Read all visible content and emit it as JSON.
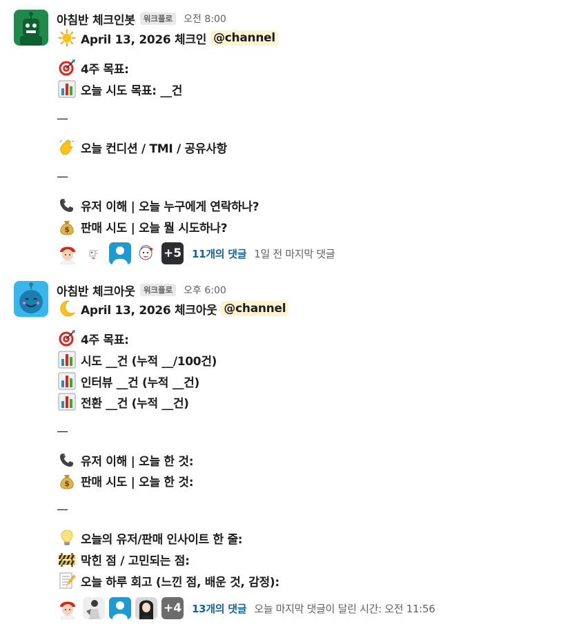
{
  "messages": [
    {
      "sender": "아침반 체크인봇",
      "app_badge": "워크플로",
      "time": "오전 8:00",
      "avatar_icon": "robot-green-icon",
      "title_text": "April 13, 2026 체크인",
      "mention": "@channel",
      "lines": [
        "4주 목표:",
        "오늘 시도 목표: __건",
        "—",
        "오늘 컨디션 / TMI / 공유사항",
        "—",
        "유저 이해 | 오늘 누구에게 연락하나?",
        "판매 시도 | 오늘 뭘 시도하나?"
      ],
      "more_count": "+5",
      "replies": "11개의 댓글",
      "last_reply": "1일 전 마지막 댓글"
    },
    {
      "sender": "아침반 체크아웃",
      "app_badge": "워크플로",
      "time": "오후 6:00",
      "avatar_icon": "robot-blue-icon",
      "title_text": "April 13, 2026 체크아웃",
      "mention": "@channel",
      "lines": [
        "4주 목표:",
        "시도 __건 (누적 __/100건)",
        "인터뷰 __건 (누적 __건)",
        "전환 __건 (누적 __건)",
        "—",
        "유저 이해 | 오늘 한 것:",
        "판매 시도 | 오늘 한 것:",
        "—",
        "오늘의 유저/판매 인사이트 한 줄:",
        "막힌 점 / 고민되는 점:",
        "오늘 하루 회고 (느낀 점, 배운 것, 감정):"
      ],
      "more_count": "+4",
      "replies": "13개의 댓글",
      "last_reply": "오늘 마지막 댓글이 달린 시간: 오전 11:56"
    }
  ],
  "colors": {
    "link": "#1264a3",
    "mention_bg": "#fdf3d1",
    "bot_green": "#1f8a4c",
    "bot_blue": "#3bb6ea"
  }
}
